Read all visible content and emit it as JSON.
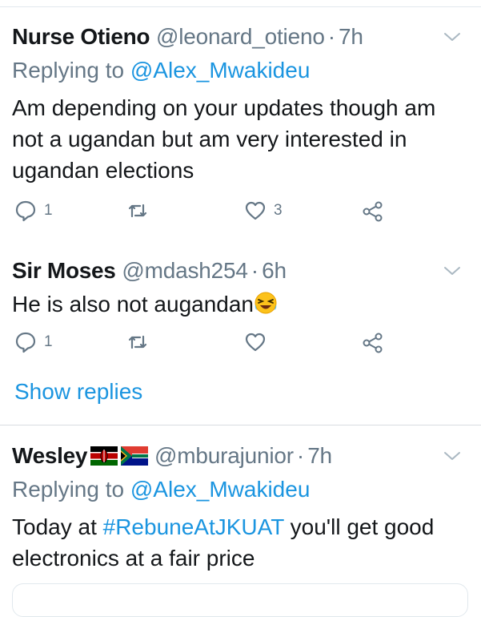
{
  "tweets": [
    {
      "name": "Nurse Otieno",
      "handle": "@leonard_otieno",
      "sep": "·",
      "time": "7h",
      "replying_prefix": "Replying to",
      "replying_to": "@Alex_Mwakideu",
      "text": "Am depending on your updates though am not a ugandan but am very interested in ugandan elections",
      "reply_count": "1",
      "retweet_count": "",
      "like_count": "3"
    },
    {
      "name": "Sir Moses",
      "handle": "@mdash254",
      "sep": "·",
      "time": "6h",
      "text": "He is also not augandan",
      "reply_count": "1",
      "retweet_count": "",
      "like_count": ""
    },
    {
      "name": "Wesley",
      "handle": "@mburajunior",
      "sep": "·",
      "time": "7h",
      "replying_prefix": "Replying to",
      "replying_to": "@Alex_Mwakideu",
      "text_before": "Today at ",
      "hashtag": "#RebuneAtJKUAT",
      "text_after": " you'll get good electronics at a fair price"
    }
  ],
  "show_replies_label": "Show replies",
  "colors": {
    "link": "#1b95e0",
    "muted": "#657786",
    "text": "#14171a",
    "divider": "#e1e8ed"
  },
  "icons": [
    "chevron-down-icon",
    "reply-icon",
    "retweet-icon",
    "like-icon",
    "share-icon",
    "laughing-emoji-icon",
    "kenya-flag-icon",
    "south-africa-flag-icon"
  ]
}
